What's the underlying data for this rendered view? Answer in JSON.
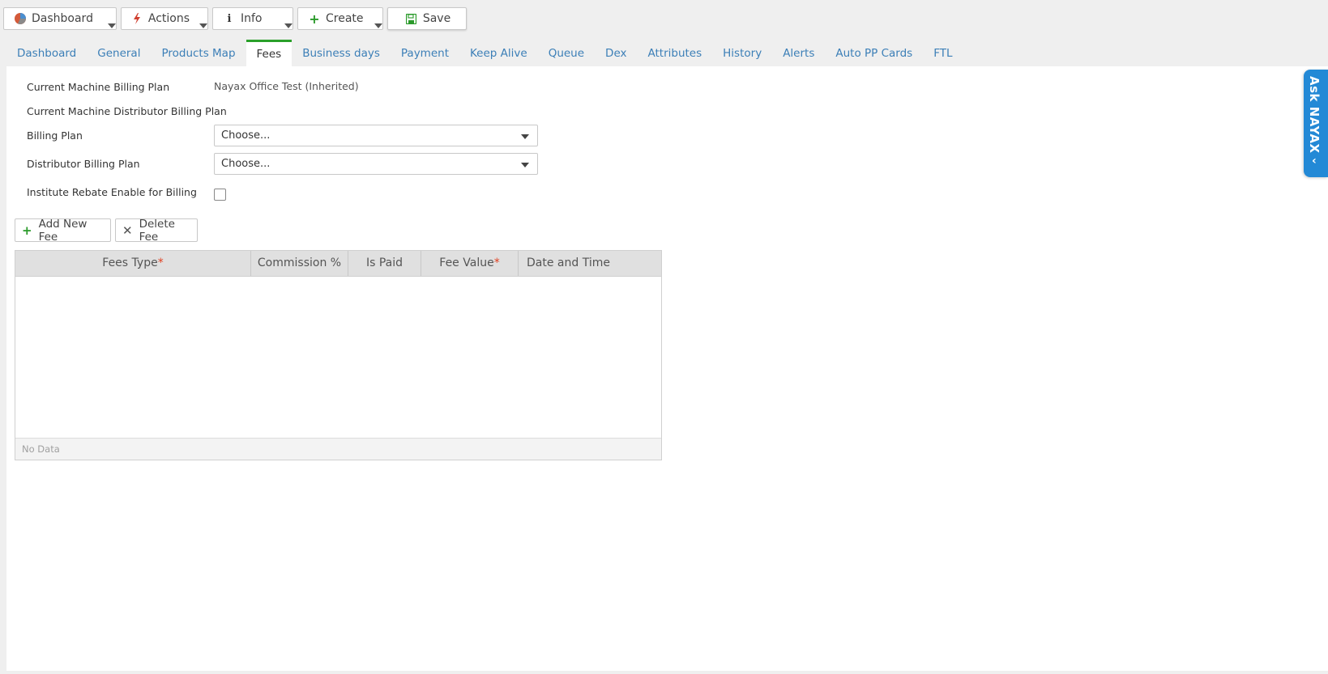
{
  "toolbar": {
    "dashboard": {
      "label": "Dashboard",
      "icon": "pie-chart-icon"
    },
    "actions": {
      "label": "Actions",
      "icon": "lightning-icon"
    },
    "info": {
      "label": "Info",
      "icon": "info-icon"
    },
    "create": {
      "label": "Create",
      "icon": "plus-icon"
    },
    "save": {
      "label": "Save",
      "icon": "floppy-disk-icon"
    }
  },
  "tabs": [
    {
      "label": "Dashboard"
    },
    {
      "label": "General"
    },
    {
      "label": "Products Map"
    },
    {
      "label": "Fees",
      "active": true
    },
    {
      "label": "Business days"
    },
    {
      "label": "Payment"
    },
    {
      "label": "Keep Alive"
    },
    {
      "label": "Queue"
    },
    {
      "label": "Dex"
    },
    {
      "label": "Attributes"
    },
    {
      "label": "History"
    },
    {
      "label": "Alerts"
    },
    {
      "label": "Auto PP Cards"
    },
    {
      "label": "FTL"
    }
  ],
  "form": {
    "current_billing_plan_label": "Current Machine Billing Plan",
    "current_billing_plan_value": "Nayax Office Test (Inherited)",
    "current_distributor_plan_label": "Current Machine Distributor Billing Plan",
    "billing_plan_label": "Billing Plan",
    "billing_plan_value": "Choose...",
    "distributor_plan_label": "Distributor Billing Plan",
    "distributor_plan_value": "Choose...",
    "rebate_label": "Institute Rebate Enable for Billing",
    "rebate_checked": false
  },
  "fee_actions": {
    "add_label": "Add New Fee",
    "delete_label": "Delete Fee"
  },
  "grid": {
    "columns": [
      {
        "label": "Fees Type",
        "required": true
      },
      {
        "label": "Commission %",
        "required": false
      },
      {
        "label": "Is Paid",
        "required": false
      },
      {
        "label": "Fee Value",
        "required": true
      },
      {
        "label": "Date and Time",
        "required": false
      }
    ],
    "empty_text": "No Data"
  },
  "ask_nayax": {
    "label": "Ask NAYAX"
  },
  "colors": {
    "accent_green": "#2aa02a",
    "tab_blue": "#3c7fb7",
    "ask_blue": "#2389d6",
    "required_red": "#e04020"
  }
}
